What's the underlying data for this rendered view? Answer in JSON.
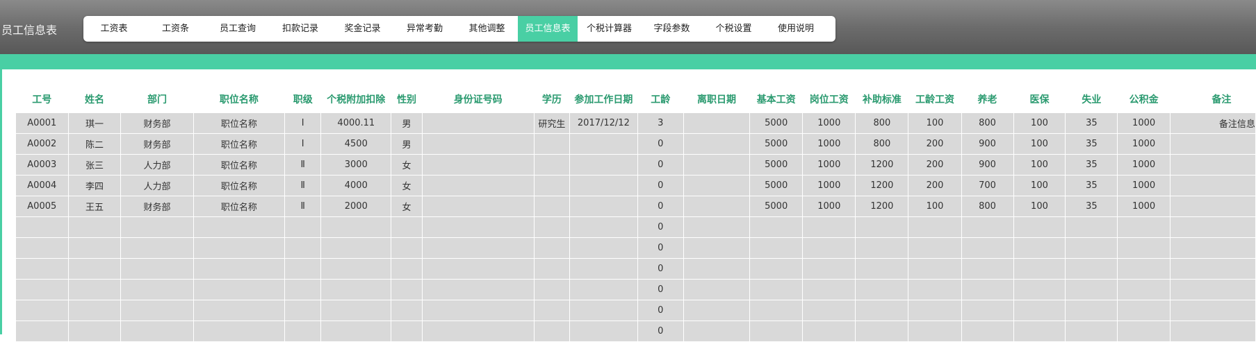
{
  "app": {
    "title": "员工信息表"
  },
  "menu": [
    {
      "label": "工资表",
      "active": false
    },
    {
      "label": "工资条",
      "active": false
    },
    {
      "label": "员工查询",
      "active": false
    },
    {
      "label": "扣款记录",
      "active": false
    },
    {
      "label": "奖金记录",
      "active": false
    },
    {
      "label": "异常考勤",
      "active": false
    },
    {
      "label": "其他调整",
      "active": false
    },
    {
      "label": "员工信息表",
      "active": true
    },
    {
      "label": "个税计算器",
      "active": false
    },
    {
      "label": "字段参数",
      "active": false
    },
    {
      "label": "个税设置",
      "active": false
    },
    {
      "label": "使用说明",
      "active": false
    }
  ],
  "colors": {
    "accent": "#49cfa4",
    "header_text": "#2a9a6f",
    "cell_bg": "#d9d9d9",
    "topbar": "#6c6c6c"
  },
  "table": {
    "columns": [
      "工号",
      "姓名",
      "部门",
      "职位名称",
      "职级",
      "个税附加扣除",
      "性别",
      "身份证号码",
      "学历",
      "参加工作日期",
      "工龄",
      "离职日期",
      "基本工资",
      "岗位工资",
      "补助标准",
      "工龄工资",
      "养老",
      "医保",
      "失业",
      "公积金",
      "备注"
    ],
    "rows": [
      [
        "A0001",
        "琪一",
        "财务部",
        "职位名称",
        "Ⅰ",
        "4000.11",
        "男",
        "",
        "研究生",
        "2017/12/12",
        "3",
        "",
        "5000",
        "1000",
        "800",
        "100",
        "800",
        "100",
        "35",
        "1000",
        "备注信息"
      ],
      [
        "A0002",
        "陈二",
        "财务部",
        "职位名称",
        "Ⅰ",
        "4500",
        "男",
        "",
        "",
        "",
        "0",
        "",
        "5000",
        "1000",
        "800",
        "200",
        "900",
        "100",
        "35",
        "1000",
        ""
      ],
      [
        "A0003",
        "张三",
        "人力部",
        "职位名称",
        "Ⅱ",
        "3000",
        "女",
        "",
        "",
        "",
        "0",
        "",
        "5000",
        "1000",
        "1200",
        "200",
        "900",
        "100",
        "35",
        "1000",
        ""
      ],
      [
        "A0004",
        "李四",
        "人力部",
        "职位名称",
        "Ⅱ",
        "4000",
        "女",
        "",
        "",
        "",
        "0",
        "",
        "5000",
        "1000",
        "1200",
        "200",
        "700",
        "100",
        "35",
        "1000",
        ""
      ],
      [
        "A0005",
        "王五",
        "财务部",
        "职位名称",
        "Ⅱ",
        "2000",
        "女",
        "",
        "",
        "",
        "0",
        "",
        "5000",
        "1000",
        "1200",
        "100",
        "800",
        "100",
        "35",
        "1000",
        ""
      ],
      [
        "",
        "",
        "",
        "",
        "",
        "",
        "",
        "",
        "",
        "",
        "0",
        "",
        "",
        "",
        "",
        "",
        "",
        "",
        "",
        "",
        ""
      ],
      [
        "",
        "",
        "",
        "",
        "",
        "",
        "",
        "",
        "",
        "",
        "0",
        "",
        "",
        "",
        "",
        "",
        "",
        "",
        "",
        "",
        ""
      ],
      [
        "",
        "",
        "",
        "",
        "",
        "",
        "",
        "",
        "",
        "",
        "0",
        "",
        "",
        "",
        "",
        "",
        "",
        "",
        "",
        "",
        ""
      ],
      [
        "",
        "",
        "",
        "",
        "",
        "",
        "",
        "",
        "",
        "",
        "0",
        "",
        "",
        "",
        "",
        "",
        "",
        "",
        "",
        "",
        ""
      ],
      [
        "",
        "",
        "",
        "",
        "",
        "",
        "",
        "",
        "",
        "",
        "0",
        "",
        "",
        "",
        "",
        "",
        "",
        "",
        "",
        "",
        ""
      ],
      [
        "",
        "",
        "",
        "",
        "",
        "",
        "",
        "",
        "",
        "",
        "0",
        "",
        "",
        "",
        "",
        "",
        "",
        "",
        "",
        "",
        ""
      ]
    ]
  }
}
